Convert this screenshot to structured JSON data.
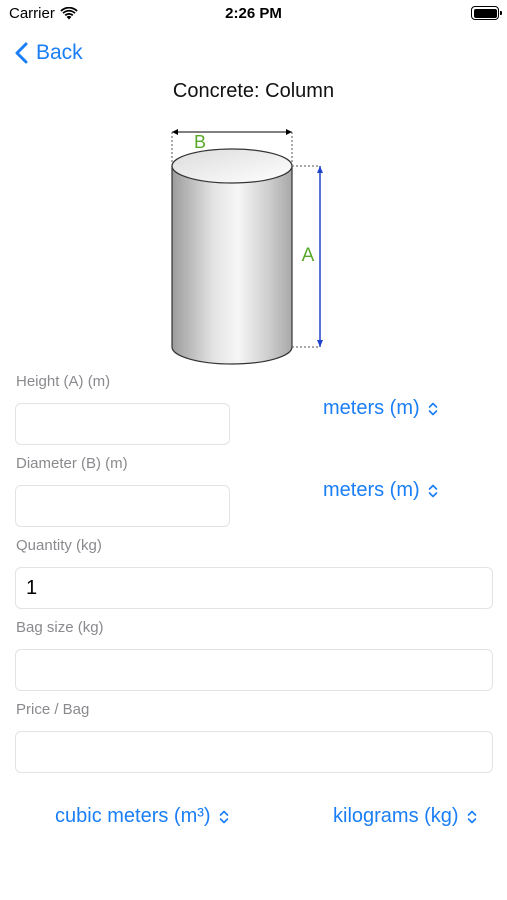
{
  "status_bar": {
    "carrier": "Carrier",
    "time": "2:26 PM"
  },
  "nav": {
    "back_label": "Back",
    "title": "Concrete: Column"
  },
  "diagram": {
    "label_a": "A",
    "label_b": "B"
  },
  "fields": {
    "height": {
      "label": "Height (A) (m)",
      "value": "",
      "unit": "meters (m)"
    },
    "diameter": {
      "label": "Diameter (B) (m)",
      "value": "",
      "unit": "meters (m)"
    },
    "quantity": {
      "label": "Quantity (kg)",
      "value": "1"
    },
    "bag_size": {
      "label": "Bag size (kg)",
      "value": ""
    },
    "price_bag": {
      "label": "Price / Bag",
      "value": ""
    }
  },
  "bottom_units": {
    "volume_unit": "cubic meters (m³)",
    "mass_unit": "kilograms (kg)"
  },
  "colors": {
    "accent": "#1a7ef6",
    "label_green": "#5aa82a",
    "dimension_blue": "#2244cc"
  },
  "icons": [
    "back-chevron-icon",
    "wifi-icon",
    "battery-icon",
    "updown-chevron-icon"
  ]
}
